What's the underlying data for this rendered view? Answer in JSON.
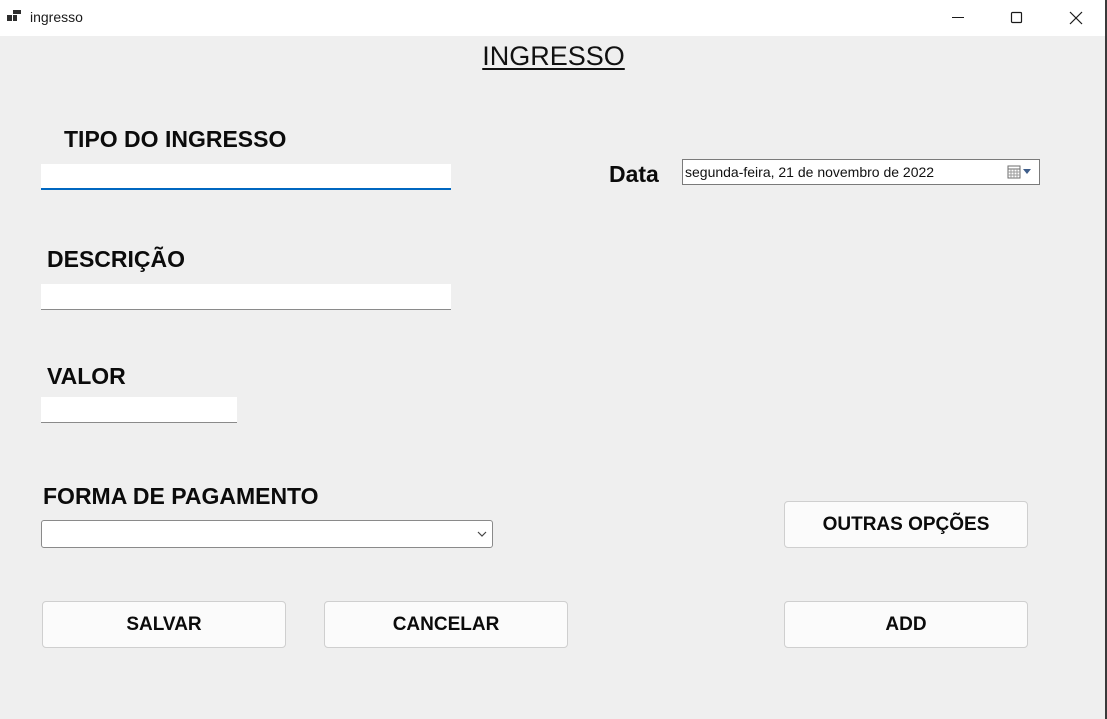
{
  "window": {
    "title": "ingresso"
  },
  "form": {
    "heading": "INGRESSO",
    "tipo_label": "TIPO DO INGRESSO",
    "tipo_value": "",
    "descricao_label": "DESCRIÇÃO",
    "descricao_value": "",
    "valor_label": "VALOR",
    "valor_value": "",
    "pagamento_label": "FORMA DE PAGAMENTO",
    "pagamento_value": "",
    "data_label": "Data",
    "data_value": "segunda-feira, 21 de novembro de 2022"
  },
  "buttons": {
    "salvar": "SALVAR",
    "cancelar": "CANCELAR",
    "add": "ADD",
    "outras_opcoes": "OUTRAS OPÇÕES"
  },
  "icons": {
    "app": "app-icon",
    "minimize": "minimize-icon",
    "maximize": "maximize-icon",
    "close": "close-icon",
    "calendar": "calendar-icon",
    "dropdown": "chevron-down-icon"
  },
  "colors": {
    "focus_accent": "#0067c0",
    "window_bg": "#efefef",
    "titlebar_bg": "#ffffff"
  }
}
